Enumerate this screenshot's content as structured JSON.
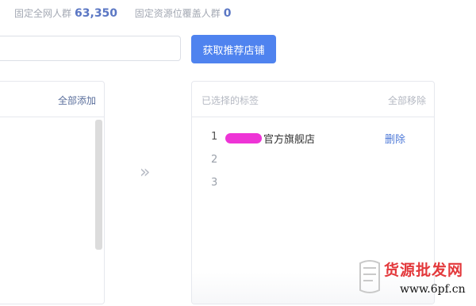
{
  "stats": {
    "full_network_label": "固定全网人群",
    "full_network_value": "63,350",
    "coverage_label": "固定资源位覆盖人群",
    "coverage_value": "0"
  },
  "search": {
    "value": "",
    "placeholder": ""
  },
  "fetch_button_label": "获取推荐店铺",
  "left_panel": {
    "add_all_label": "全部添加"
  },
  "transfer_arrow": "»",
  "right_panel": {
    "title": "已选择的标签",
    "remove_all_label": "全部移除",
    "rows": [
      {
        "index": "1",
        "name": "官方旗舰店",
        "delete_label": "删除"
      },
      {
        "index": "2"
      },
      {
        "index": "3"
      }
    ]
  },
  "watermark": {
    "text": "货源批发网",
    "url": "www.6pf.cn"
  },
  "colors": {
    "accent": "#4f83ef",
    "link": "#4f7ad8",
    "stat_value": "#5b77c4",
    "redaction": "#ee34d6",
    "watermark": "#e3393c"
  }
}
